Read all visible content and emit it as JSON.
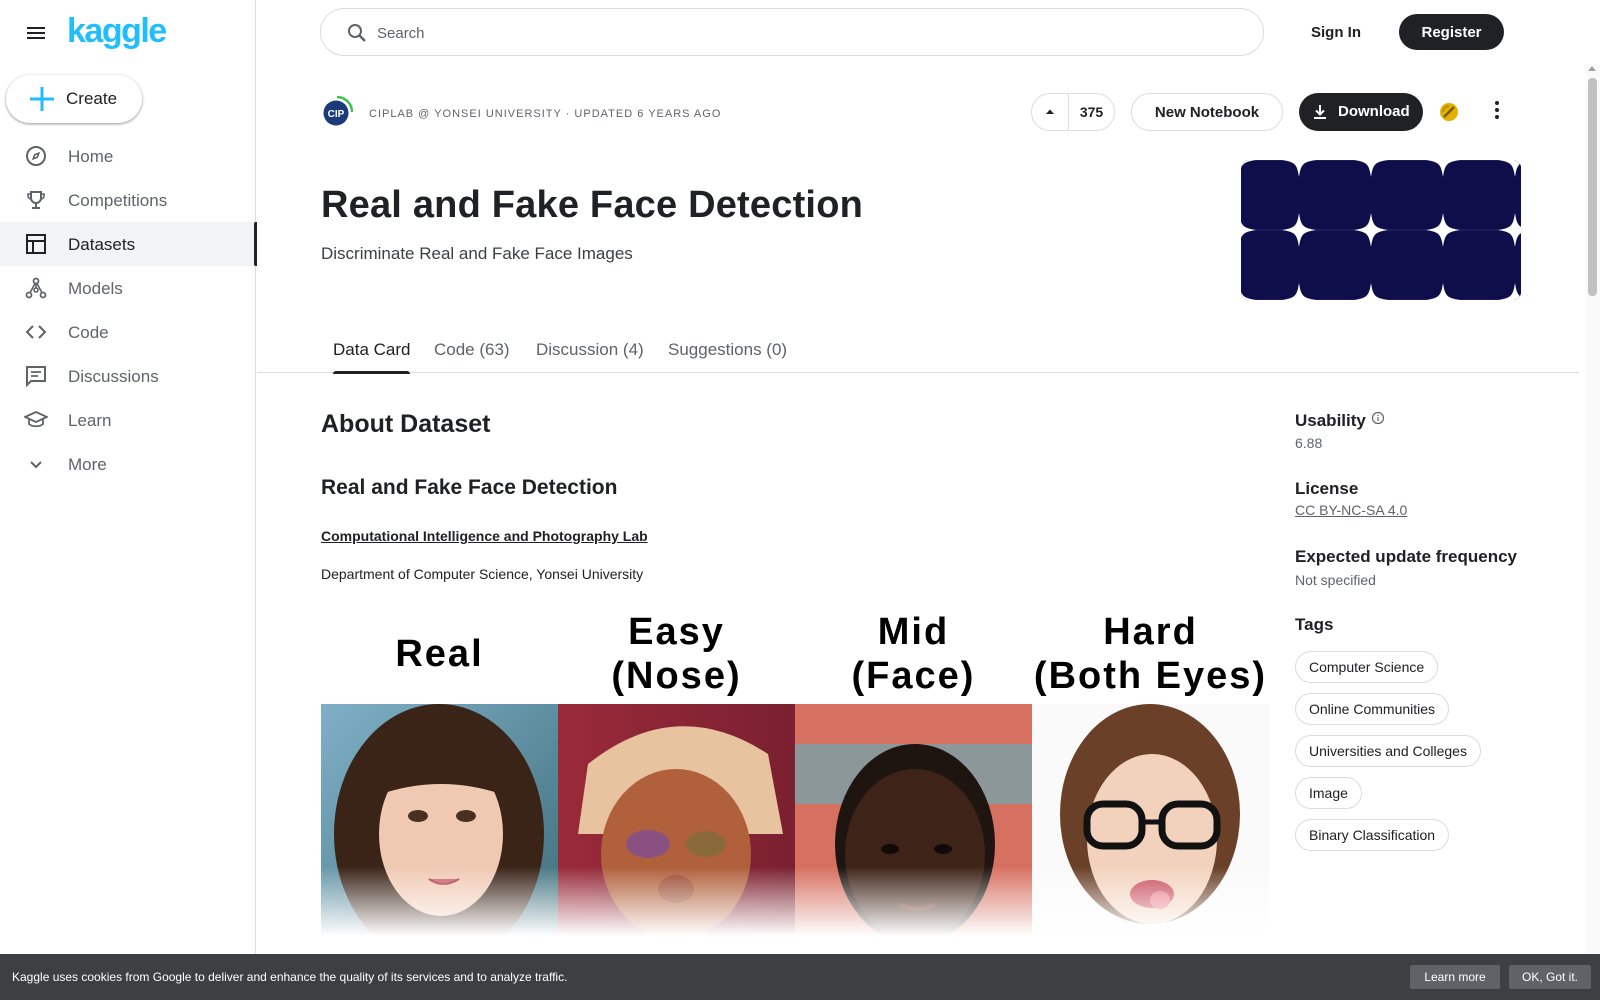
{
  "header": {
    "logo_text": "kaggle",
    "search_placeholder": "Search",
    "signin_label": "Sign In",
    "register_label": "Register"
  },
  "sidebar": {
    "create_label": "Create",
    "items": [
      {
        "label": "Home",
        "icon": "compass-icon"
      },
      {
        "label": "Competitions",
        "icon": "trophy-icon"
      },
      {
        "label": "Datasets",
        "icon": "table-icon",
        "active": true
      },
      {
        "label": "Models",
        "icon": "models-icon"
      },
      {
        "label": "Code",
        "icon": "code-icon"
      },
      {
        "label": "Discussions",
        "icon": "discussion-icon"
      },
      {
        "label": "Learn",
        "icon": "school-icon"
      },
      {
        "label": "More",
        "icon": "chevron-down-icon"
      }
    ]
  },
  "dataset": {
    "owner_line": "CIPLAB @ YONSEI UNIVERSITY · UPDATED 6 YEARS AGO",
    "owner_logo_text": "CIP",
    "vote_count": "375",
    "new_notebook_label": "New Notebook",
    "download_label": "Download",
    "title": "Real and Fake Face Detection",
    "subtitle": "Discriminate Real and Fake Face Images"
  },
  "tabs": [
    {
      "label": "Data Card",
      "active": true
    },
    {
      "label": "Code (63)"
    },
    {
      "label": "Discussion (4)"
    },
    {
      "label": "Suggestions (0)"
    }
  ],
  "content": {
    "about_heading": "About Dataset",
    "section_heading": "Real and Fake Face Detection",
    "lab_link": "Computational Intelligence and Photography Lab",
    "department": "Department of Computer Science, Yonsei University",
    "face_labels": [
      {
        "line1": "Real",
        "line2": ""
      },
      {
        "line1": "Easy",
        "line2": "(Nose)"
      },
      {
        "line1": "Mid",
        "line2": "(Face)"
      },
      {
        "line1": "Hard",
        "line2": "(Both Eyes)"
      }
    ]
  },
  "right_panel": {
    "usability_label": "Usability",
    "usability_value": "6.88",
    "license_label": "License",
    "license_value": "CC BY-NC-SA 4.0",
    "update_label": "Expected update frequency",
    "update_value": "Not specified",
    "tags_label": "Tags",
    "tags": [
      "Computer Science",
      "Online Communities",
      "Universities and Colleges",
      "Image",
      "Binary Classification"
    ]
  },
  "cookie_bar": {
    "message": "Kaggle uses cookies from Google to deliver and enhance the quality of its services and to analyze traffic.",
    "learn_more": "Learn more",
    "ok": "OK, Got it."
  },
  "colors": {
    "brand": "#20beff",
    "dark": "#202124",
    "banner": "#0e0e4a"
  }
}
